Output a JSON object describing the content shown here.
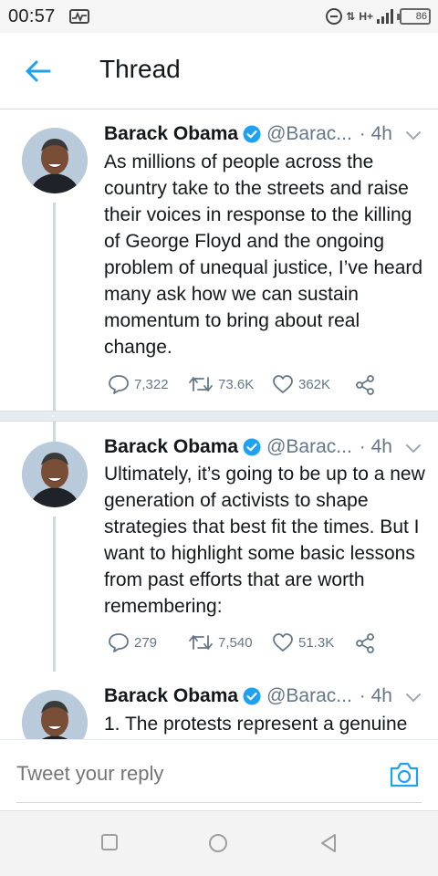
{
  "status_bar": {
    "time": "00:57",
    "network": "H+",
    "battery": "86"
  },
  "header": {
    "title": "Thread"
  },
  "tweets": [
    {
      "name": "Barack Obama",
      "handle": "@Barac...",
      "time": "· 4h",
      "text": "As millions of people across the country take to the streets and raise their voices in response to the killing of George Floyd and the ongoing problem of unequal justice, I’ve heard many ask how we can sustain momentum to bring about real change.",
      "replies": "7,322",
      "retweets": "73.6K",
      "likes": "362K"
    },
    {
      "name": "Barack Obama",
      "handle": "@Barac...",
      "time": "· 4h",
      "text": "Ultimately, it’s going to be up to a new generation of activists to shape strategies that best fit the times. But I want to highlight some basic lessons from past efforts that are worth remembering:",
      "replies": "279",
      "retweets": "7,540",
      "likes": "51.3K"
    },
    {
      "name": "Barack Obama",
      "handle": "@Barac...",
      "time": "· 4h",
      "text": "1. The protests represent a genuine"
    }
  ],
  "reply": {
    "placeholder": "Tweet your reply"
  },
  "colors": {
    "accent": "#1da1f2",
    "secondary_text": "#657786",
    "separator": "#e6ecf0"
  }
}
